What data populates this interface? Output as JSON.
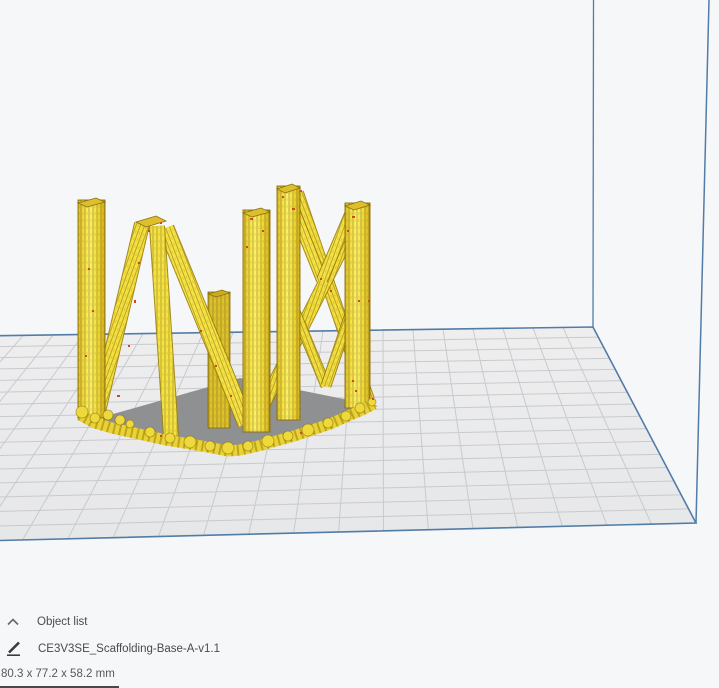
{
  "viewport": {
    "description": "3D build plate view with printable model",
    "model_color": "#f4e03e"
  },
  "object_list_panel": {
    "title": "Object list",
    "collapse_icon": "chevron-up-icon",
    "items": [
      {
        "icon": "pencil-icon",
        "name": "CE3V3SE_Scaffolding-Base-A-v1.1"
      }
    ]
  },
  "selection_info": {
    "dimensions": "80.3 x 77.2 x 58.2 mm"
  },
  "colors": {
    "background": "#f6f7f8",
    "plate_fill_back": "#eeeeef",
    "plate_fill_front": "#e6e7e9",
    "grid_line": "#c9cacd",
    "plate_border_blue": "#527ca8",
    "build_volume_line_blue": "#527ca8",
    "model_yellow": "#f4e03e",
    "model_yellow_light": "#fbee5c",
    "model_yellow_dark": "#c9a81e",
    "model_outline": "#8a6f08",
    "shadow_gray": "#8f9091",
    "speckle_red": "#d2491b",
    "footer_text": "#4c4c4c"
  }
}
